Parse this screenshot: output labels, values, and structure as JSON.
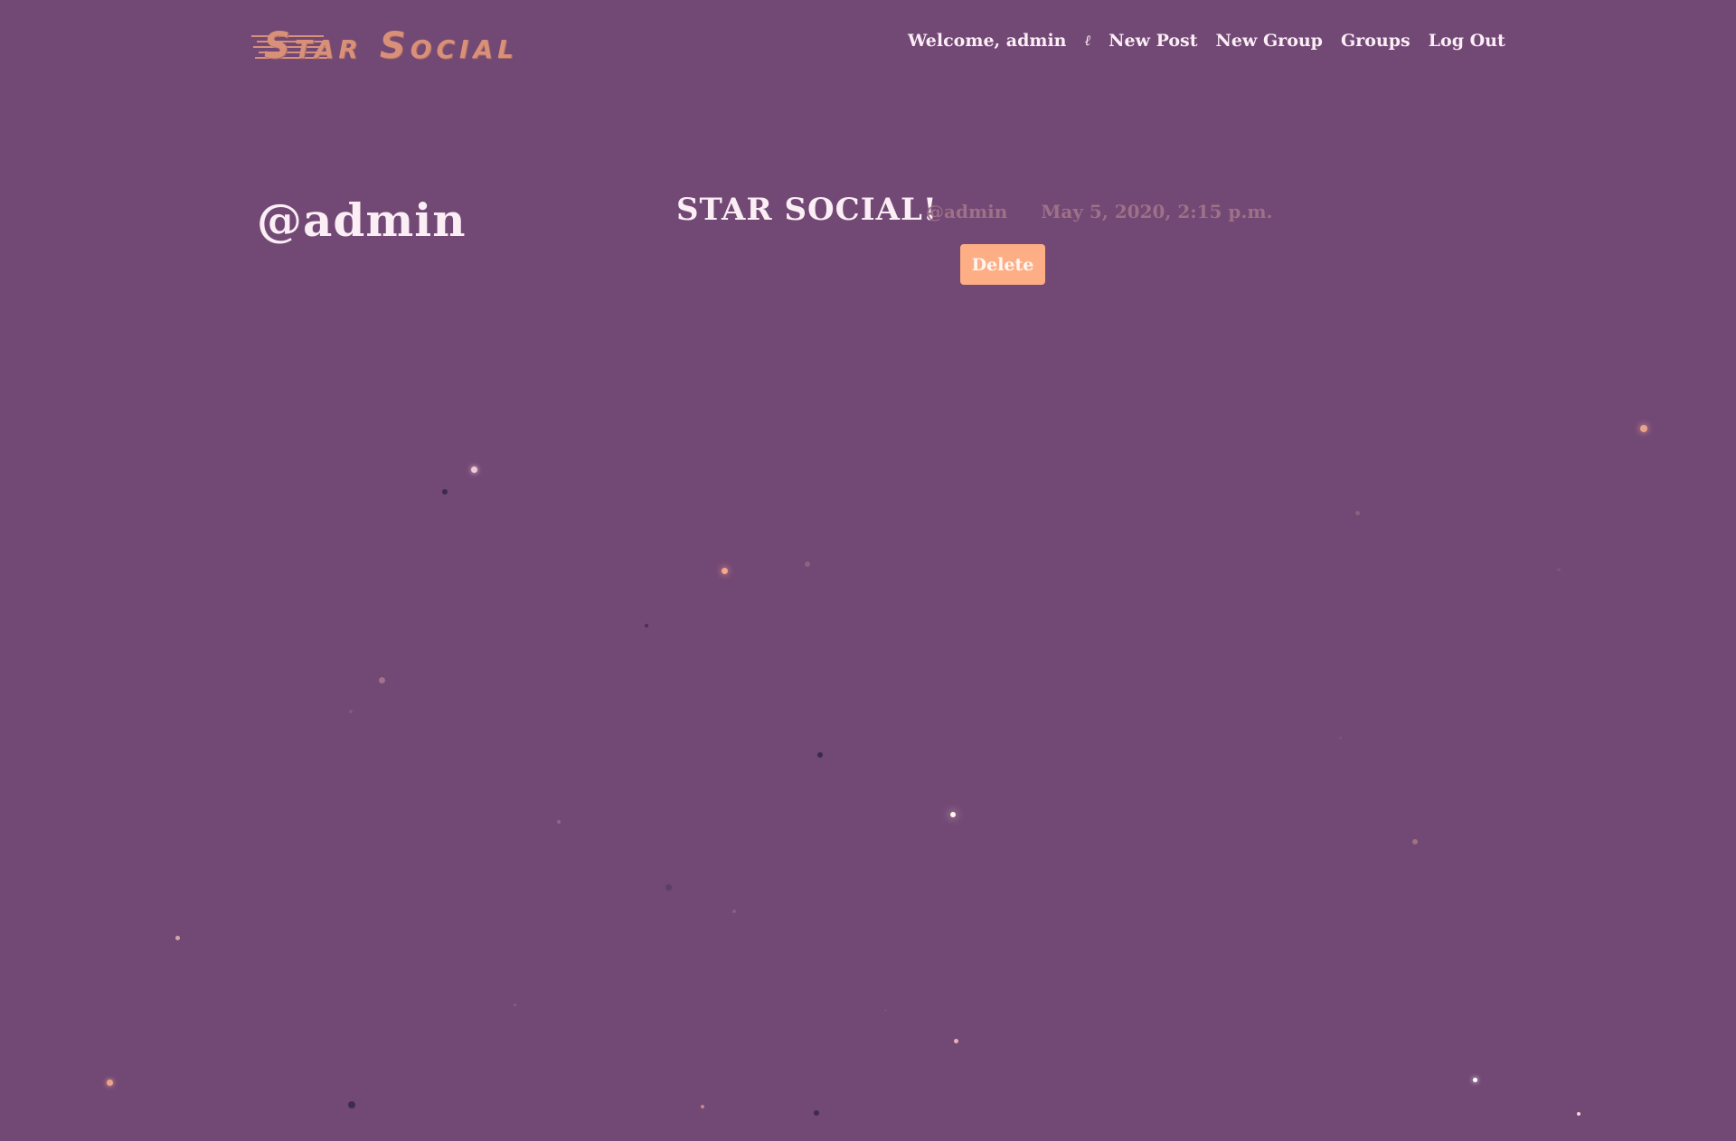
{
  "brand": {
    "name": "Star Social",
    "color": "#d99078"
  },
  "nav": {
    "welcome": "Welcome, admin",
    "separator": "ℓ",
    "new_post": "New Post",
    "new_group": "New Group",
    "groups": "Groups",
    "log_out": "Log Out"
  },
  "profile": {
    "username": "@admin"
  },
  "post": {
    "title": "STAR SOCIAL!",
    "author": "@admin",
    "timestamp": "May 5, 2020, 2:15 p.m.",
    "delete_label": "Delete"
  },
  "colors": {
    "background": "#724875",
    "text": "#fbeef5",
    "muted": "#9d7187",
    "accent": "#fdae85"
  }
}
